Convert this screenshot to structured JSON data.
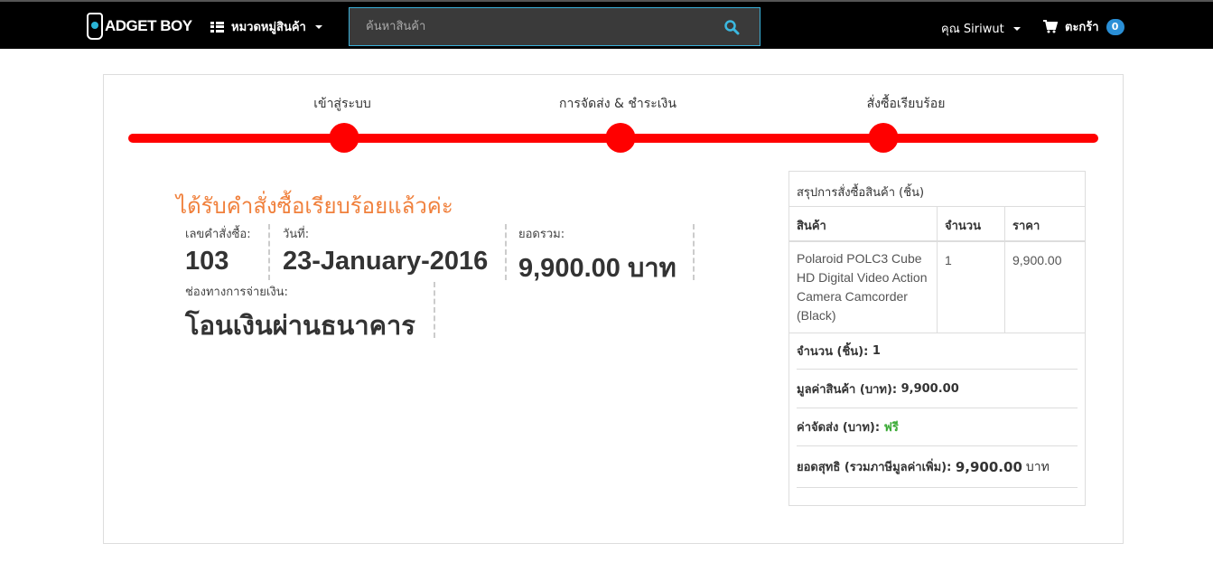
{
  "navbar": {
    "logo_text": "ADGET BOY",
    "category_label": "หมวดหมู่สินค้า",
    "search_placeholder": "ค้นหาสินค้า",
    "user_label": "คุณ Siriwut",
    "cart_label": "ตะกร้า",
    "cart_count": "0"
  },
  "progress": {
    "steps": [
      "เข้าสู่ระบบ",
      "การจัดส่ง & ชำระเงิน",
      "สั่งซื้อเรียบร้อย"
    ],
    "color": "#ff0000"
  },
  "confirmation": {
    "title": "ได้รับคำสั่งซื้อเรียบร้อยแล้วค่ะ",
    "order_no_label": "เลขคำสั่งซื้อ:",
    "order_no": "103",
    "date_label": "วันที่:",
    "date": "23-January-2016",
    "total_label": "ยอดรวม:",
    "total": "9,900.00 บาท",
    "payment_label": "ช่องทางการจ่ายเงิน:",
    "payment": "โอนเงินผ่านธนาคาร"
  },
  "summary": {
    "title": "สรุปการสั่งซื้อสินค้า (ชิ้น)",
    "columns": [
      "สินค้า",
      "จำนวน",
      "ราคา"
    ],
    "rows": [
      {
        "product": "Polaroid POLC3 Cube HD Digital Video Action Camera Camcorder (Black)",
        "qty": "1",
        "price": "9,900.00"
      }
    ],
    "qty_label": "จำนวน (ชิ้น):",
    "qty_value": "1",
    "subtotal_label": "มูลค่าสินค้า (บาท):",
    "subtotal_value": "9,900.00",
    "shipping_label": "ค่าจัดส่ง (บาท):",
    "shipping_value": "ฟรี",
    "net_label": "ยอดสุทธิ (รวมภาษีมูลค่าเพิ่ม):",
    "net_value": "9,900.00",
    "net_unit": "บาท"
  },
  "colors": {
    "accent_orange": "#f0803c",
    "progress_red": "#ff0000",
    "free_green": "#3aaa35",
    "badge_blue": "#2a8fd6"
  }
}
